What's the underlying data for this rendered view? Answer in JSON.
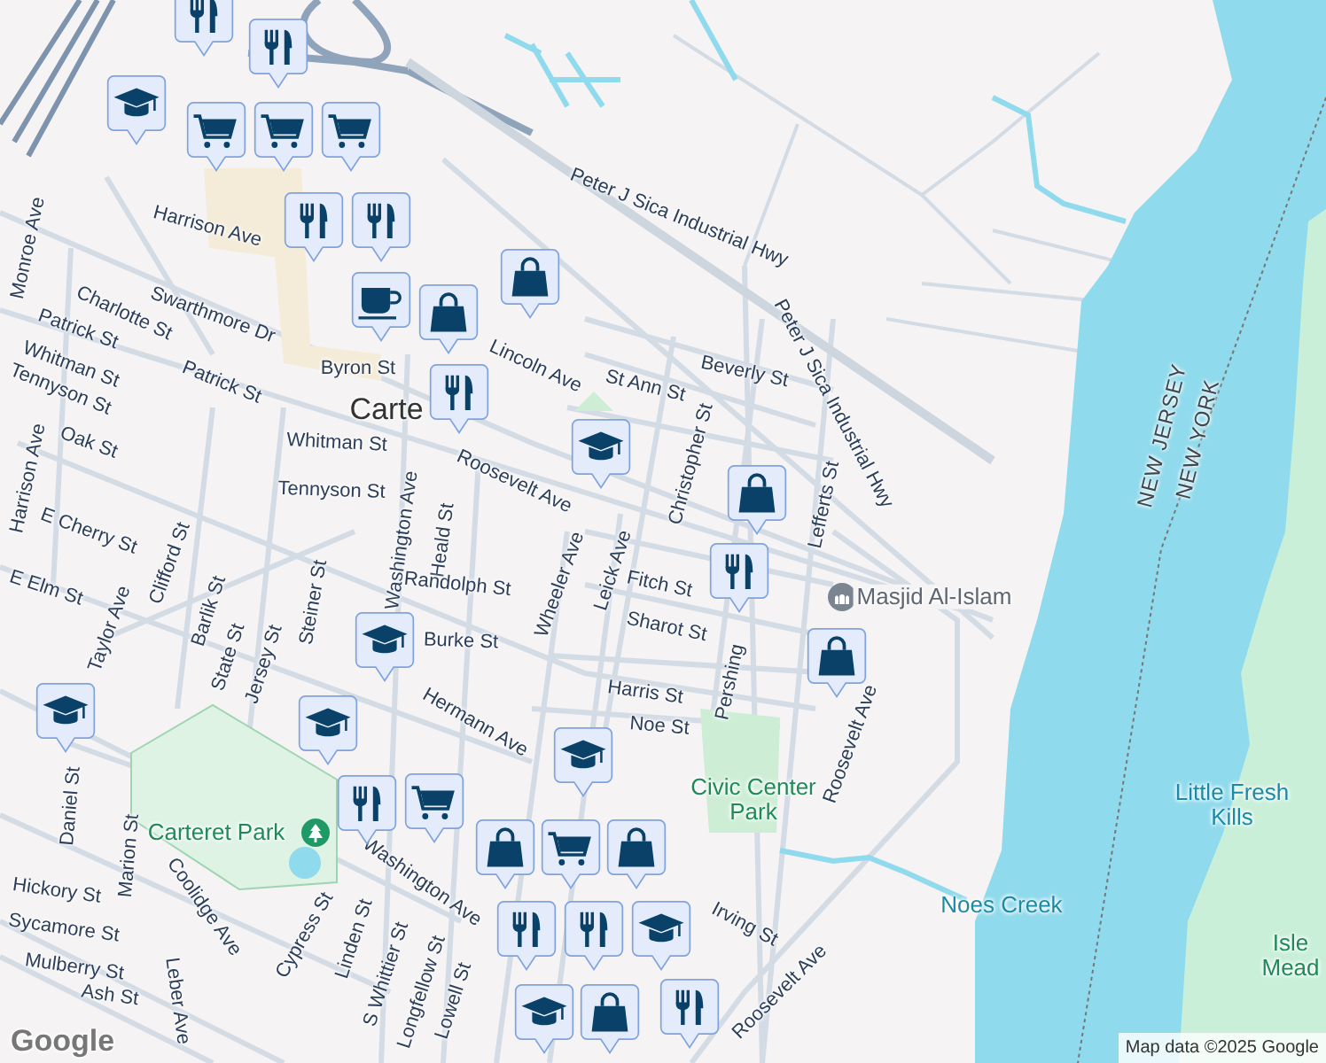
{
  "map": {
    "labels": [
      {
        "text": "Peter J Sica Industrial Hwy",
        "kind": "street"
      },
      {
        "text": "Peter J Sica Industrial Hwy",
        "kind": "street"
      },
      {
        "text": "Beverly St",
        "kind": "street"
      },
      {
        "text": "St Ann St",
        "kind": "street"
      },
      {
        "text": "Christopher St",
        "kind": "street"
      },
      {
        "text": "Lefferts St",
        "kind": "street"
      },
      {
        "text": "Harrison Ave",
        "kind": "street"
      },
      {
        "text": "Swarthmore Dr",
        "kind": "street"
      },
      {
        "text": "Charlotte St",
        "kind": "street"
      },
      {
        "text": "Patrick St",
        "kind": "street"
      },
      {
        "text": "Whitman St",
        "kind": "street"
      },
      {
        "text": "Tennyson St",
        "kind": "street"
      },
      {
        "text": "Patrick St",
        "kind": "street"
      },
      {
        "text": "Byron St",
        "kind": "street"
      },
      {
        "text": "Carte",
        "kind": "town"
      },
      {
        "text": "Whitman St",
        "kind": "street"
      },
      {
        "text": "Tennyson St",
        "kind": "street"
      },
      {
        "text": "Roosevelt Ave",
        "kind": "street"
      },
      {
        "text": "Lincoln Ave",
        "kind": "street"
      },
      {
        "text": "Oak St",
        "kind": "street"
      },
      {
        "text": "Monroe Ave",
        "kind": "street"
      },
      {
        "text": "Harrison Ave",
        "kind": "street"
      },
      {
        "text": "E Cherry St",
        "kind": "street"
      },
      {
        "text": "Heald St",
        "kind": "street"
      },
      {
        "text": "Washington Ave",
        "kind": "street"
      },
      {
        "text": "Steiner St",
        "kind": "street"
      },
      {
        "text": "Randolph St",
        "kind": "street"
      },
      {
        "text": "Wheeler Ave",
        "kind": "street"
      },
      {
        "text": "Leick Ave",
        "kind": "street"
      },
      {
        "text": "Fitch St",
        "kind": "street"
      },
      {
        "text": "Sharot St",
        "kind": "street"
      },
      {
        "text": "Pershing",
        "kind": "street"
      },
      {
        "text": "Harris St",
        "kind": "street"
      },
      {
        "text": "Noe St",
        "kind": "street"
      },
      {
        "text": "Burke St",
        "kind": "street"
      },
      {
        "text": "Hermann Ave",
        "kind": "street"
      },
      {
        "text": "E Elm St",
        "kind": "street"
      },
      {
        "text": "Taylor Ave",
        "kind": "street"
      },
      {
        "text": "Clifford St",
        "kind": "street"
      },
      {
        "text": "Barlik St",
        "kind": "street"
      },
      {
        "text": "State St",
        "kind": "street"
      },
      {
        "text": "Jersey St",
        "kind": "street"
      },
      {
        "text": "Daniel St",
        "kind": "street"
      },
      {
        "text": "Marion St",
        "kind": "street"
      },
      {
        "text": "Hickory St",
        "kind": "street"
      },
      {
        "text": "Sycamore St",
        "kind": "street"
      },
      {
        "text": "Mulberry St",
        "kind": "street"
      },
      {
        "text": "Ash St",
        "kind": "street"
      },
      {
        "text": "Coolidge Ave",
        "kind": "street"
      },
      {
        "text": "Leber Ave",
        "kind": "street"
      },
      {
        "text": "Cypress St",
        "kind": "street"
      },
      {
        "text": "Linden St",
        "kind": "street"
      },
      {
        "text": "S Whittier St",
        "kind": "street"
      },
      {
        "text": "Longfellow St",
        "kind": "street"
      },
      {
        "text": "Lowell St",
        "kind": "street"
      },
      {
        "text": "Washington Ave",
        "kind": "street"
      },
      {
        "text": "Carteret Park",
        "kind": "park_poi"
      },
      {
        "text": "Roosevelt Ave",
        "kind": "street"
      },
      {
        "text": "Roosevelt Ave",
        "kind": "street"
      },
      {
        "text": "Irving St",
        "kind": "street"
      },
      {
        "text": "Civic Center Park",
        "kind": "park"
      },
      {
        "text": "Noes Creek",
        "kind": "water"
      },
      {
        "text": "Little Fresh Kills",
        "kind": "water"
      },
      {
        "text": "Isle Mead",
        "kind": "park"
      },
      {
        "text": "NEW JERSEY",
        "kind": "region"
      },
      {
        "text": "NEW YORK",
        "kind": "region"
      },
      {
        "text": "Masjid Al-Islam",
        "kind": "worship_poi"
      }
    ],
    "pins": [
      {
        "kind": "restaurant"
      },
      {
        "kind": "school"
      },
      {
        "kind": "restaurant"
      },
      {
        "kind": "grocery"
      },
      {
        "kind": "grocery"
      },
      {
        "kind": "grocery"
      },
      {
        "kind": "restaurant"
      },
      {
        "kind": "restaurant"
      },
      {
        "kind": "cafe"
      },
      {
        "kind": "shopping"
      },
      {
        "kind": "shopping"
      },
      {
        "kind": "restaurant"
      },
      {
        "kind": "school"
      },
      {
        "kind": "shopping"
      },
      {
        "kind": "restaurant"
      },
      {
        "kind": "shopping"
      },
      {
        "kind": "school"
      },
      {
        "kind": "school"
      },
      {
        "kind": "school"
      },
      {
        "kind": "restaurant"
      },
      {
        "kind": "grocery"
      },
      {
        "kind": "school"
      },
      {
        "kind": "shopping"
      },
      {
        "kind": "grocery"
      },
      {
        "kind": "shopping"
      },
      {
        "kind": "restaurant"
      },
      {
        "kind": "restaurant"
      },
      {
        "kind": "school"
      },
      {
        "kind": "restaurant"
      },
      {
        "kind": "school"
      },
      {
        "kind": "shopping"
      }
    ]
  },
  "logo": "Google",
  "attribution": "Map data ©2025 Google"
}
